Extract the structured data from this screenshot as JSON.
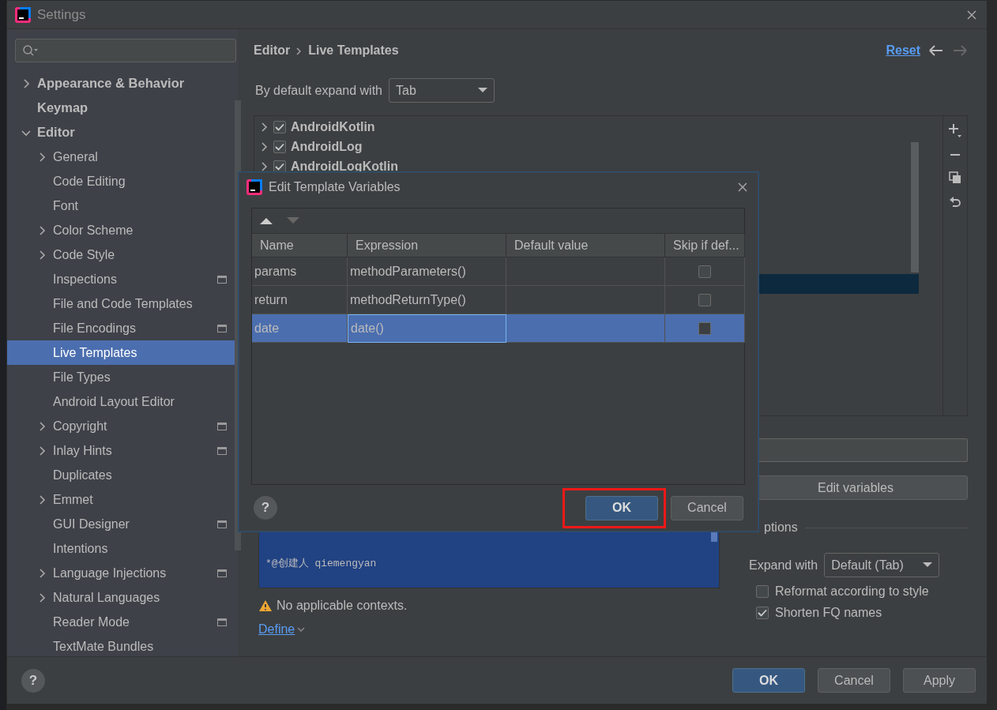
{
  "window": {
    "title": "Settings"
  },
  "sidebar": {
    "items": [
      {
        "label": "Appearance & Behavior",
        "kind": "group",
        "expanded": false,
        "project_scoped": false,
        "selected": false
      },
      {
        "label": "Keymap",
        "kind": "page",
        "project_scoped": false,
        "selected": false
      },
      {
        "label": "Editor",
        "kind": "group",
        "expanded": true,
        "project_scoped": false,
        "selected": false,
        "children": [
          {
            "label": "General",
            "kind": "group",
            "expanded": false,
            "project_scoped": false,
            "selected": false
          },
          {
            "label": "Code Editing",
            "kind": "page",
            "project_scoped": false,
            "selected": false
          },
          {
            "label": "Font",
            "kind": "page",
            "project_scoped": false,
            "selected": false
          },
          {
            "label": "Color Scheme",
            "kind": "group",
            "expanded": false,
            "project_scoped": false,
            "selected": false
          },
          {
            "label": "Code Style",
            "kind": "group",
            "expanded": false,
            "project_scoped": false,
            "selected": false
          },
          {
            "label": "Inspections",
            "kind": "page",
            "project_scoped": true,
            "selected": false
          },
          {
            "label": "File and Code Templates",
            "kind": "page",
            "project_scoped": false,
            "selected": false
          },
          {
            "label": "File Encodings",
            "kind": "page",
            "project_scoped": true,
            "selected": false
          },
          {
            "label": "Live Templates",
            "kind": "page",
            "project_scoped": false,
            "selected": true
          },
          {
            "label": "File Types",
            "kind": "page",
            "project_scoped": false,
            "selected": false
          },
          {
            "label": "Android Layout Editor",
            "kind": "page",
            "project_scoped": false,
            "selected": false
          },
          {
            "label": "Copyright",
            "kind": "group",
            "expanded": false,
            "project_scoped": true,
            "selected": false
          },
          {
            "label": "Inlay Hints",
            "kind": "group",
            "expanded": false,
            "project_scoped": true,
            "selected": false
          },
          {
            "label": "Duplicates",
            "kind": "page",
            "project_scoped": false,
            "selected": false
          },
          {
            "label": "Emmet",
            "kind": "group",
            "expanded": false,
            "project_scoped": false,
            "selected": false
          },
          {
            "label": "GUI Designer",
            "kind": "page",
            "project_scoped": true,
            "selected": false
          },
          {
            "label": "Intentions",
            "kind": "page",
            "project_scoped": false,
            "selected": false
          },
          {
            "label": "Language Injections",
            "kind": "group",
            "expanded": false,
            "project_scoped": true,
            "selected": false
          },
          {
            "label": "Natural Languages",
            "kind": "group",
            "expanded": false,
            "project_scoped": false,
            "selected": false
          },
          {
            "label": "Reader Mode",
            "kind": "page",
            "project_scoped": true,
            "selected": false
          },
          {
            "label": "TextMate Bundles",
            "kind": "page",
            "project_scoped": false,
            "selected": false
          }
        ]
      }
    ]
  },
  "header": {
    "breadcrumb": [
      "Editor",
      "Live Templates"
    ],
    "reset": "Reset"
  },
  "expand_default": {
    "label": "By default expand with",
    "value": "Tab"
  },
  "template_list": {
    "selection_band": true,
    "items": [
      {
        "label": "AndroidKotlin",
        "checked": true,
        "expanded": false
      },
      {
        "label": "AndroidLog",
        "checked": true,
        "expanded": false
      },
      {
        "label": "AndroidLogKotlin",
        "checked": true,
        "expanded": false
      }
    ]
  },
  "template_text": {
    "lines": [
      "*@创建人 qiemengyan"
    ]
  },
  "context": {
    "warning": "No applicable contexts.",
    "define": "Define"
  },
  "edit_variables": "Edit variables",
  "options": {
    "title": "ptions",
    "expand_label": "Expand with",
    "expand_value": "Default (Tab)",
    "checkboxes": [
      {
        "label": "Reformat according to style",
        "checked": false
      },
      {
        "label": "Shorten FQ names",
        "checked": true
      }
    ]
  },
  "footer": {
    "help": "?",
    "buttons": [
      {
        "label": "OK",
        "kind": "primary"
      },
      {
        "label": "Cancel",
        "kind": "default"
      },
      {
        "label": "Apply",
        "kind": "default"
      }
    ]
  },
  "dialog": {
    "title": "Edit Template Variables",
    "columns": [
      "Name",
      "Expression",
      "Default value",
      "Skip if def..."
    ],
    "rows": [
      {
        "name": "params",
        "expression": "methodParameters()",
        "skip": false,
        "selected": false
      },
      {
        "name": "return",
        "expression": "methodReturnType()",
        "skip": false,
        "selected": false
      },
      {
        "name": "date",
        "expression": "date()",
        "skip": false,
        "selected": true
      }
    ],
    "help": "?",
    "buttons": [
      {
        "label": "OK",
        "kind": "primary",
        "annotated": true
      },
      {
        "label": "Cancel",
        "kind": "default",
        "annotated": false
      }
    ]
  }
}
